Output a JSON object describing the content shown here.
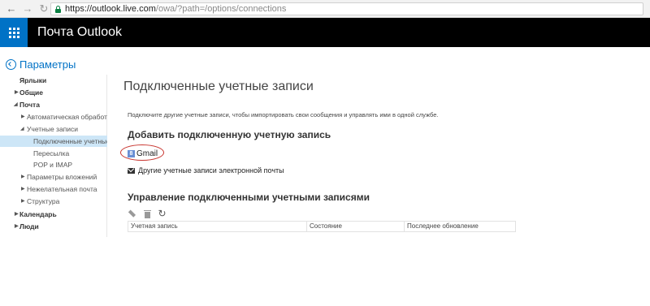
{
  "browser": {
    "url_host": "https://outlook.live.com",
    "url_path": "/owa/?path=/options/connections"
  },
  "header": {
    "app_title": "Почта Outlook",
    "accent": "#0072c6"
  },
  "leftnav": {
    "back_label": "Параметры",
    "items": [
      {
        "label": "Ярлыки"
      },
      {
        "label": "Общие"
      },
      {
        "label": "Почта"
      },
      {
        "label": "Автоматическая обработка"
      },
      {
        "label": "Учетные записи"
      },
      {
        "label": "Подключенные учетные записи"
      },
      {
        "label": "Пересылка"
      },
      {
        "label": "POP и IMAP"
      },
      {
        "label": "Параметры вложений"
      },
      {
        "label": "Нежелательная почта"
      },
      {
        "label": "Структура"
      },
      {
        "label": "Календарь"
      },
      {
        "label": "Люди"
      }
    ]
  },
  "main": {
    "title": "Подключенные учетные записи",
    "intro": "Подключите другие учетные записи, чтобы импортировать свои сообщения и управлять ими в одной службе.",
    "add_heading": "Добавить подключенную учетную запись",
    "gmail_label": "Gmail",
    "other_label": "Другие учетные записи электронной почты",
    "manage_heading": "Управление подключенными учетными записями",
    "columns": [
      "Учетная запись",
      "Состояние",
      "Последнее обновление"
    ]
  }
}
